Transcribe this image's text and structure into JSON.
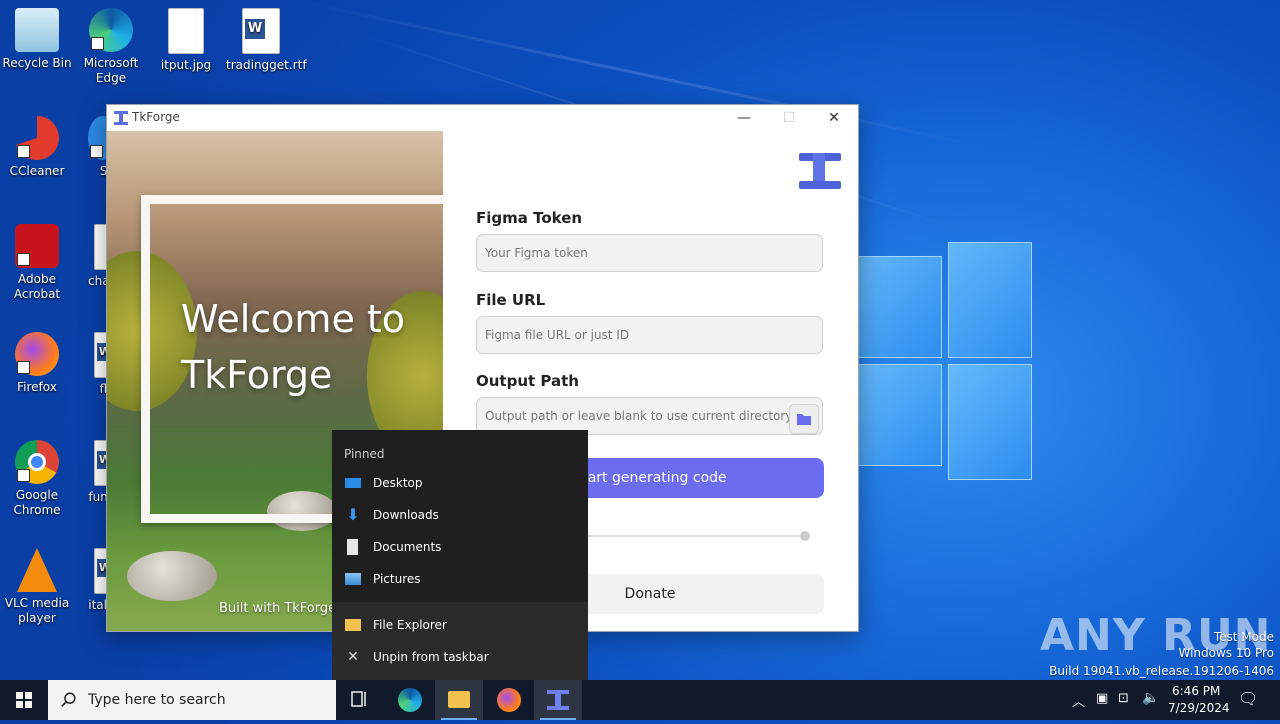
{
  "desktop": {
    "icons": [
      {
        "label": "Recycle Bin"
      },
      {
        "label": "Microsoft Edge"
      },
      {
        "label": "itput.jpg"
      },
      {
        "label": "tradingget.rtf"
      },
      {
        "label": "CCleaner"
      },
      {
        "label": "Sk"
      },
      {
        "label": "Adobe Acrobat"
      },
      {
        "label": "chapt"
      },
      {
        "label": "Firefox"
      },
      {
        "label": "fla"
      },
      {
        "label": "Google Chrome"
      },
      {
        "label": "funds"
      },
      {
        "label": "VLC media player"
      },
      {
        "label": "italyp"
      }
    ],
    "watermark": "ANY RUN",
    "os_info": {
      "line1": "Test Mode",
      "line2": "Windows 10 Pro",
      "line3": "Build 19041.vb_release.191206-1406"
    }
  },
  "app": {
    "title": "TkForge",
    "controls": {
      "minimize": "—",
      "maximize": "☐",
      "close": "✕"
    },
    "welcome": "Welcome to TkForge",
    "built_with": "Built with TkForge",
    "fields": [
      {
        "label": "Figma Token",
        "placeholder": "Your Figma token"
      },
      {
        "label": "File URL",
        "placeholder": "Figma file URL or just ID"
      },
      {
        "label": "Output Path",
        "placeholder": "Output path or leave blank to use current directory"
      }
    ],
    "generate_label": "Start generating code",
    "donate_label": "Donate",
    "accent": "#6c6cf0"
  },
  "jumplist": {
    "header": "Pinned",
    "pinned": [
      {
        "label": "Desktop"
      },
      {
        "label": "Downloads"
      },
      {
        "label": "Documents"
      },
      {
        "label": "Pictures"
      }
    ],
    "actions": [
      {
        "label": "File Explorer"
      },
      {
        "label": "Unpin from taskbar"
      }
    ]
  },
  "taskbar": {
    "search_placeholder": "Type here to search",
    "time": "6:46 PM",
    "date": "7/29/2024"
  }
}
